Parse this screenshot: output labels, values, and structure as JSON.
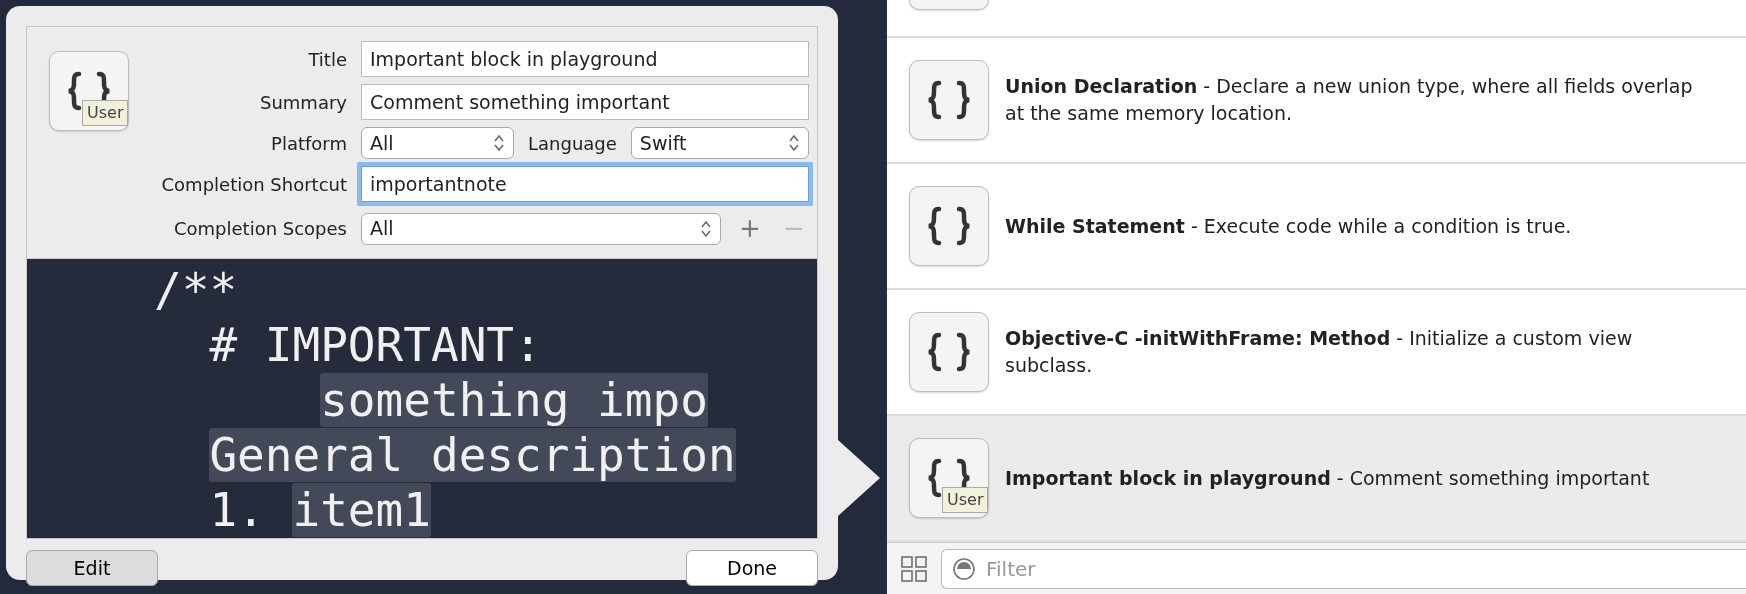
{
  "editor": {
    "icon_badge": "User",
    "fields": [
      {
        "kind": "text",
        "label": "Title",
        "value": "Important block in playground",
        "focused": false
      },
      {
        "kind": "text",
        "label": "Summary",
        "value": "Comment something important",
        "focused": false
      },
      {
        "kind": "selects",
        "items": [
          {
            "label": "Platform",
            "value": "All"
          },
          {
            "label": "Language",
            "value": "Swift"
          }
        ]
      },
      {
        "kind": "text",
        "label": "Completion Shortcut",
        "value": "importantnote",
        "focused": true
      },
      {
        "kind": "scopes",
        "label": "Completion Scopes",
        "value": "All",
        "add": "+",
        "remove": "−"
      }
    ],
    "code": [
      [
        {
          "text": "/**",
          "highlighted": false
        }
      ],
      [
        {
          "text": "  # IMPORTANT:",
          "highlighted": false
        }
      ],
      [
        {
          "text": "      something impo",
          "highlighted": true
        }
      ],
      [
        {
          "text": "  General description",
          "highlighted": true
        }
      ],
      [
        {
          "text": "  1. ",
          "highlighted": false
        },
        {
          "text": "item1",
          "highlighted": true
        }
      ]
    ],
    "buttons": [
      {
        "label": "Edit",
        "pressed": true
      },
      {
        "label": "Done",
        "pressed": false
      }
    ]
  },
  "library": {
    "items": [
      {
        "text": "**Union Declaration** - Declare a new union type, where all fields overlap at the same memory location.",
        "selected": false
      },
      {
        "text": "**While Statement** - Execute code while a condition is true.",
        "selected": false
      },
      {
        "text": "**Objective-C -initWithFrame: Method** - Initialize a custom view subclass.",
        "selected": false
      },
      {
        "text": "**Important block in playground** - Comment something important",
        "selected": true,
        "badge": "User"
      }
    ],
    "filter": {
      "placeholder": "Filter"
    }
  }
}
